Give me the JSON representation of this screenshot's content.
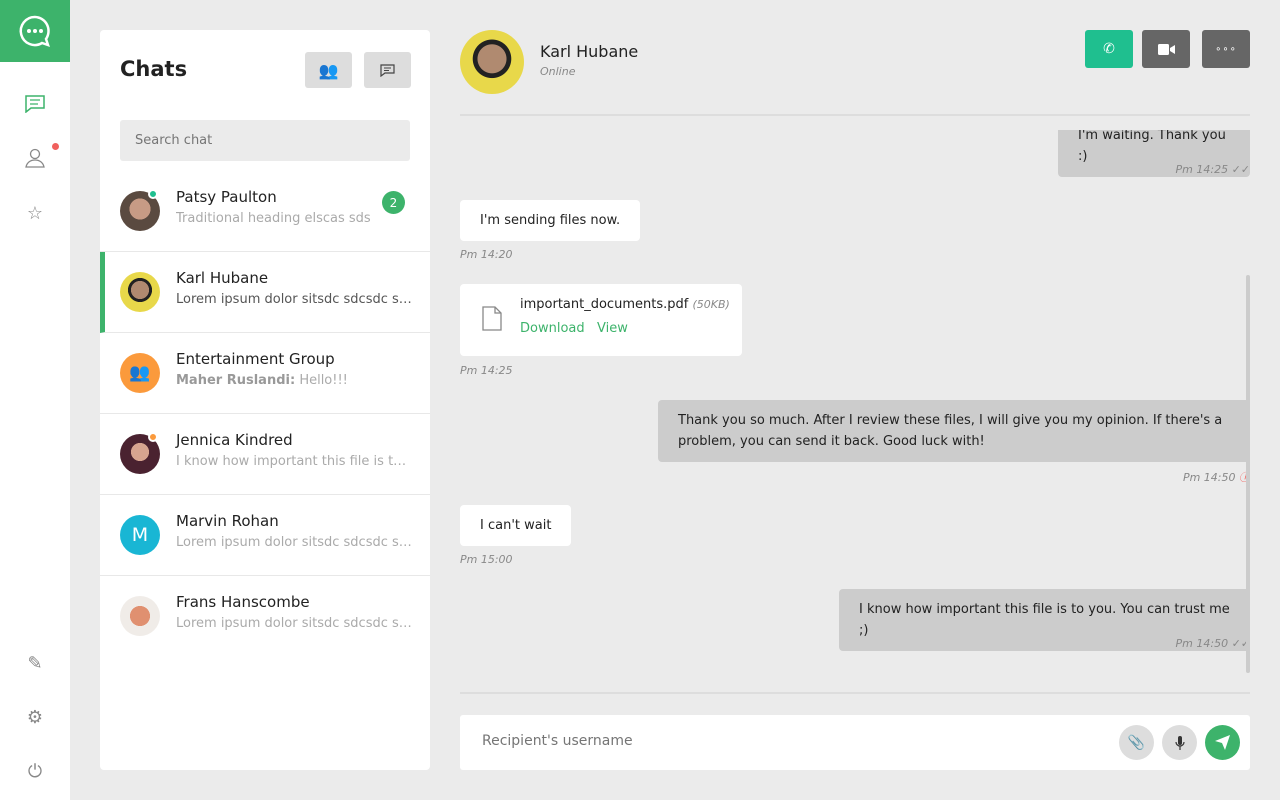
{
  "nav": {
    "items": [
      "chat-icon",
      "user-icon",
      "star-icon",
      "pencil-icon",
      "gear-icon",
      "power-icon"
    ]
  },
  "colors": {
    "accent": "#3db36b",
    "call": "#1fbf8f",
    "notification": "#f0605d",
    "group": "#fb9a3c",
    "marvin": "#19b6d4"
  },
  "chats": {
    "title": "Chats",
    "search_placeholder": "Search chat",
    "items": [
      {
        "name": "Patsy Paulton",
        "preview": "Traditional heading elscas sdscsd",
        "unread": "2",
        "status": "online"
      },
      {
        "name": "Karl Hubane",
        "preview": "Lorem ipsum dolor sitsdc sdcsdc sdcsdc",
        "active": true
      },
      {
        "name": "Entertainment Group",
        "sender": "Maher Ruslandi:",
        "preview": "Hello!!!"
      },
      {
        "name": "Jennica Kindred",
        "preview": "I know how important this file is to you",
        "status": "away"
      },
      {
        "name": "Marvin Rohan",
        "initial": "M",
        "preview": "Lorem ipsum dolor sitsdc sdcsdc sdcsdc"
      },
      {
        "name": "Frans Hanscombe",
        "preview": "Lorem ipsum dolor sitsdc sdcsdc sdcsdc"
      }
    ]
  },
  "conversation": {
    "name": "Karl Hubane",
    "status": "Online",
    "messages": [
      {
        "dir": "out",
        "text": "I'm waiting. Thank you :)",
        "time": "Pm 14:25"
      },
      {
        "dir": "in",
        "text": "I'm sending files now.",
        "time": "Pm 14:20"
      },
      {
        "dir": "in",
        "file": "important_documents.pdf",
        "size": "(50KB)",
        "download": "Download",
        "view": "View",
        "time": "Pm 14:25"
      },
      {
        "dir": "out",
        "text": "Thank you so much. After I review these files, I will give you my opinion. If there's a problem, you can send it back. Good luck with!",
        "time": "Pm 14:50"
      },
      {
        "dir": "in",
        "text": "I can't wait",
        "time": "Pm 15:00"
      },
      {
        "dir": "out",
        "text": "I know how important this file is to you. You can trust me ;)",
        "time": "Pm 14:50"
      }
    ],
    "input_placeholder": "Recipient's username"
  }
}
